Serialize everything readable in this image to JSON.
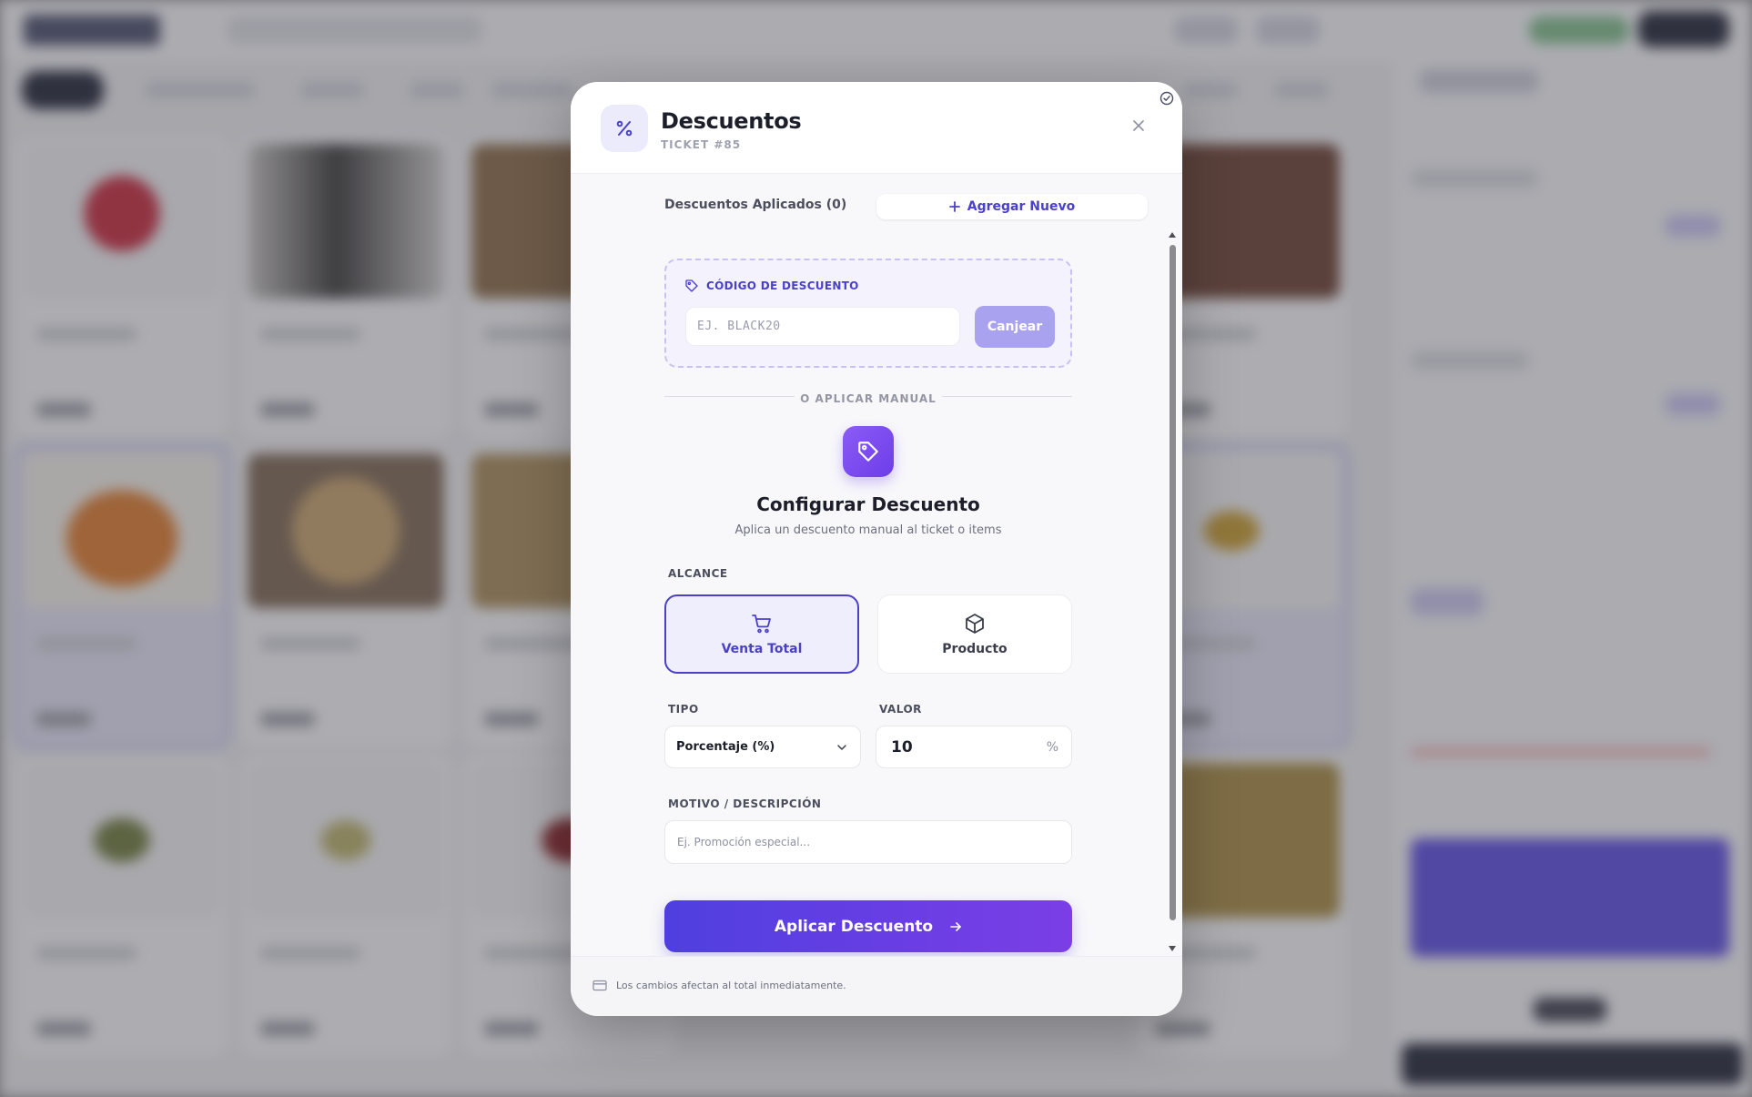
{
  "modal": {
    "title": "Descuentos",
    "subtitle": "TICKET #85",
    "applied_label": "Descuentos Aplicados (0)",
    "add_new_label": "Agregar Nuevo",
    "code_section_label": "CÓDIGO DE DESCUENTO",
    "code_placeholder": "EJ. BLACK20",
    "redeem_label": "Canjear",
    "divider_text": "O APLICAR MANUAL",
    "config_title": "Configurar Descuento",
    "config_desc": "Aplica un descuento manual al ticket o items",
    "scope_label": "ALCANCE",
    "scope_options": [
      {
        "label": "Venta Total",
        "icon": "cart-icon",
        "selected": true
      },
      {
        "label": "Producto",
        "icon": "box-icon",
        "selected": false
      }
    ],
    "type_label": "TIPO",
    "type_value": "Porcentaje (%)",
    "value_label": "VALOR",
    "value": "10",
    "value_unit": "%",
    "reason_label": "MOTIVO / DESCRIPCIÓN",
    "reason_placeholder": "Ej. Promoción especial...",
    "apply_label": "Aplicar Descuento",
    "footer_note": "Los cambios afectan al total inmediatamente."
  },
  "colors": {
    "accent": "#4a41c8",
    "accent_gradient_start": "#4f3fe0",
    "accent_gradient_end": "#7b3ee6",
    "redeem_button": "#a9a3ef"
  }
}
